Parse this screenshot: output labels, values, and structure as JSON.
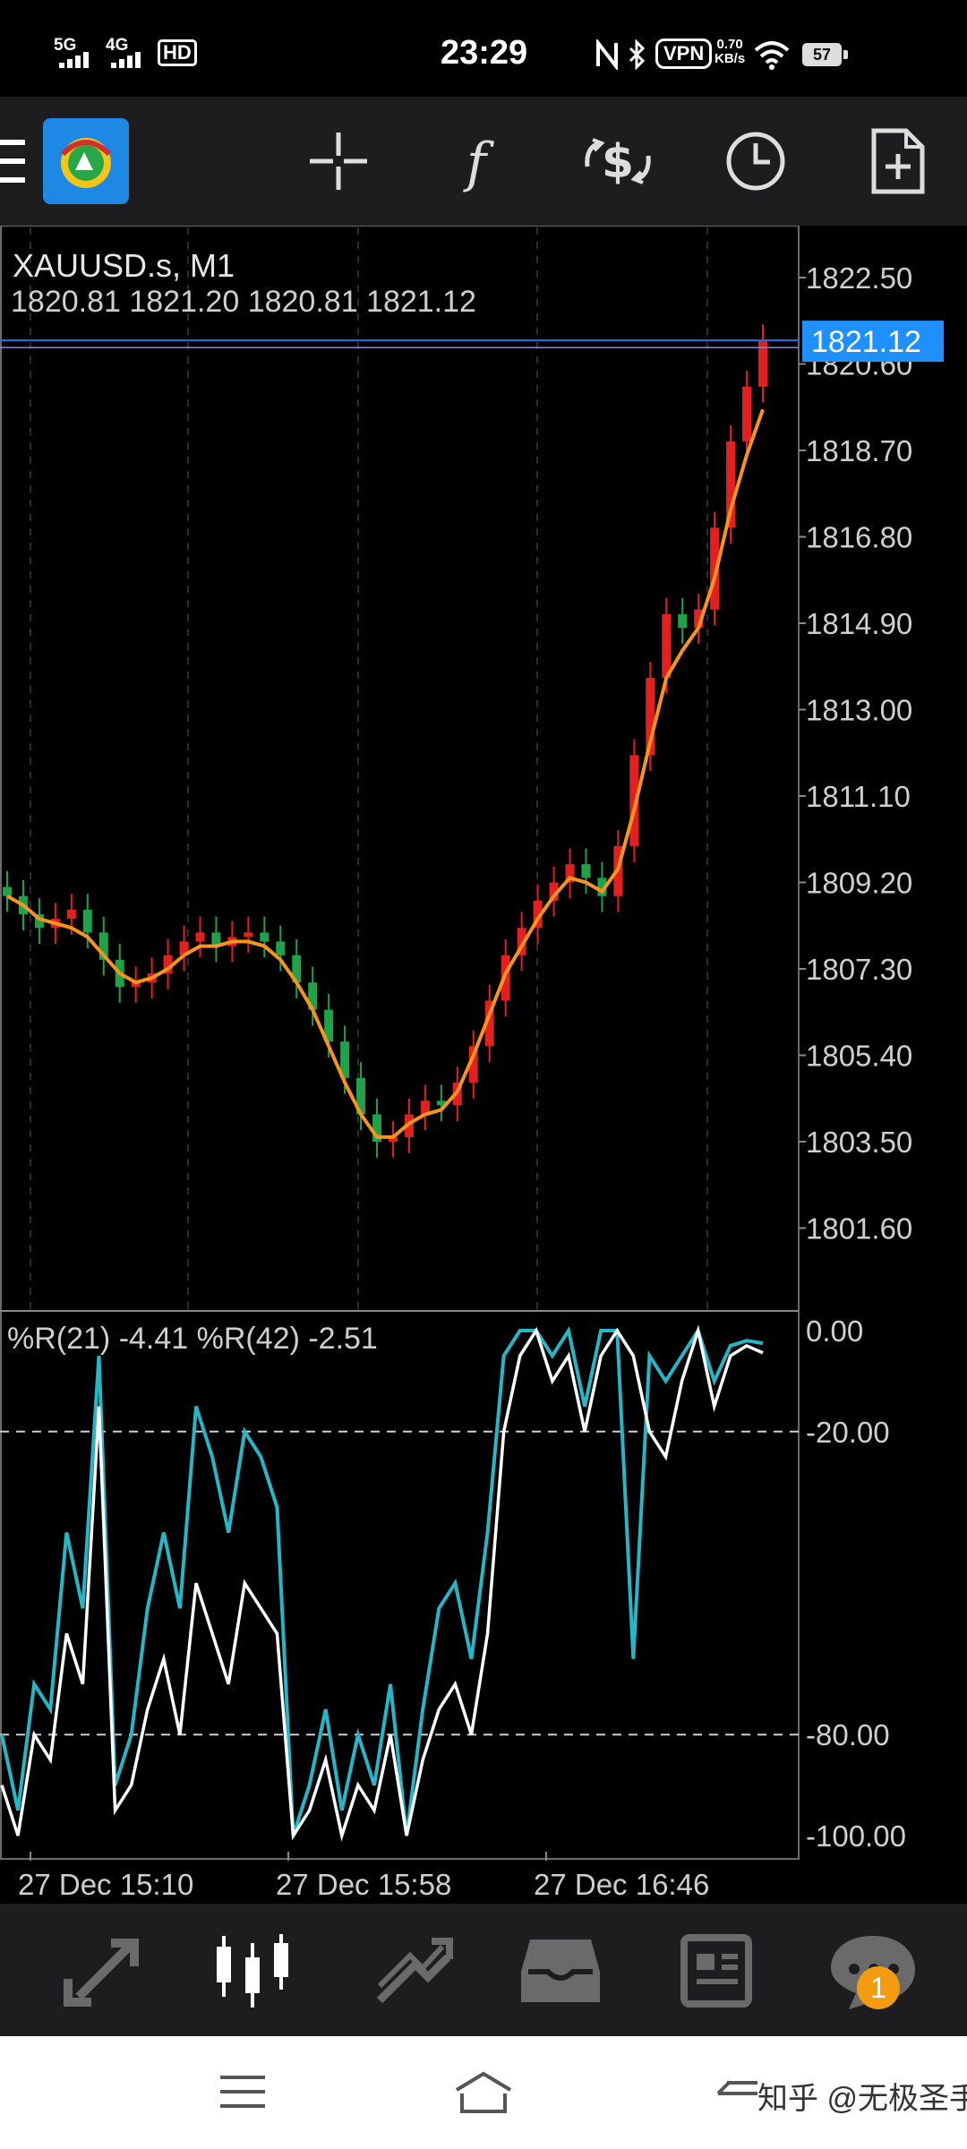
{
  "status_bar": {
    "network1": "5G",
    "network2": "4G",
    "hd_label": "HD",
    "time": "23:29",
    "vpn_label": "VPN",
    "speed_value": "0.70",
    "speed_unit": "KB/s",
    "battery": "57"
  },
  "toolbar": {
    "app_logo": "metatrader-logo-icon",
    "items": [
      "menu-icon",
      "crosshair-icon",
      "indicators-icon",
      "trade-icon",
      "timeframe-clock-icon",
      "new-order-icon"
    ]
  },
  "chart": {
    "symbol_label": "XAUUSD.s, M1",
    "ohlc": "1820.81 1821.20 1820.81 1821.12",
    "current_price": "1821.12",
    "price_ticks": [
      "1822.50",
      "1820.60",
      "1818.70",
      "1816.80",
      "1814.90",
      "1813.00",
      "1811.10",
      "1809.20",
      "1807.30",
      "1805.40",
      "1803.50",
      "1801.60"
    ],
    "indicator_label": "%R(21) -4.41 %R(42) -2.51",
    "indicator_ticks": [
      "0.00",
      "-20.00",
      "-80.00",
      "-100.00"
    ],
    "time_labels": [
      "27 Dec 15:10",
      "27 Dec 15:58",
      "27 Dec 16:46"
    ],
    "colors": {
      "bull": "#e32020",
      "bear": "#1fa24a",
      "ma": "#f7941d",
      "wpr21": "#ffffff",
      "wpr42": "#27b6c6",
      "price_line": "#2a6ee8",
      "price_badge": "#1e90ff"
    }
  },
  "chart_data": [
    {
      "type": "line",
      "title": "XAUUSD.s, M1",
      "series": [
        {
          "values": [
            1808.9,
            1808.5,
            1808.2,
            1808.4,
            1808.6,
            1808.1,
            1807.5,
            1806.9,
            1807.0,
            1807.2,
            1807.6,
            1807.9,
            1808.1,
            1807.8,
            1808.0,
            1808.1,
            1807.9,
            1807.6,
            1807.0,
            1806.4,
            1805.7,
            1804.9,
            1804.1,
            1803.5,
            1803.6,
            1804.1,
            1804.4,
            1804.3,
            1804.8,
            1805.6,
            1806.6,
            1807.6,
            1808.2,
            1808.8,
            1809.2,
            1809.6,
            1809.3,
            1808.9,
            1810.0,
            1812.0,
            1813.7,
            1815.1,
            1814.8,
            1815.2,
            1817.0,
            1818.9,
            1820.1,
            1821.12
          ]
        },
        {
          "values": [
            1808.9,
            1808.7,
            1808.4,
            1808.3,
            1808.2,
            1808.0,
            1807.6,
            1807.2,
            1807.0,
            1807.1,
            1807.3,
            1807.6,
            1807.8,
            1807.8,
            1807.9,
            1807.9,
            1807.8,
            1807.5,
            1807.0,
            1806.4,
            1805.6,
            1804.8,
            1804.1,
            1803.6,
            1803.6,
            1803.9,
            1804.1,
            1804.2,
            1804.6,
            1805.4,
            1806.3,
            1807.2,
            1807.8,
            1808.4,
            1808.9,
            1809.3,
            1809.2,
            1809.0,
            1809.5,
            1810.8,
            1812.3,
            1813.7,
            1814.3,
            1814.8,
            1815.9,
            1817.4,
            1818.6,
            1819.6
          ]
        }
      ],
      "ylim": [
        1800.0,
        1823.5
      ]
    },
    {
      "type": "line",
      "title": "%R(21) -4.41 %R(42) -2.51",
      "series": [
        {
          "values": [
            -90,
            -100,
            -80,
            -85,
            -60,
            -70,
            -15,
            -95,
            -90,
            -75,
            -65,
            -80,
            -50,
            -60,
            -70,
            -50,
            -55,
            -60,
            -100,
            -95,
            -85,
            -100,
            -90,
            -95,
            -80,
            -100,
            -85,
            -75,
            -70,
            -80,
            -60,
            -20,
            -5,
            0,
            -10,
            -5,
            -20,
            -5,
            0,
            -5,
            -20,
            -25,
            -10,
            0,
            -15,
            -5,
            -3,
            -4.41
          ]
        },
        {
          "values": [
            -80,
            -95,
            -70,
            -75,
            -40,
            -55,
            -5,
            -90,
            -80,
            -55,
            -40,
            -55,
            -15,
            -25,
            -40,
            -20,
            -25,
            -35,
            -100,
            -90,
            -75,
            -95,
            -80,
            -90,
            -70,
            -100,
            -75,
            -55,
            -50,
            -65,
            -40,
            -5,
            0,
            0,
            -5,
            0,
            -15,
            0,
            0,
            -65,
            -5,
            -10,
            -5,
            0,
            -10,
            -3,
            -2,
            -2.51
          ]
        }
      ],
      "ylim": [
        -100,
        0
      ]
    }
  ],
  "tabbar": {
    "items": [
      "quotes-icon",
      "chart-tab-icon",
      "trade-tab-icon",
      "history-tab-icon",
      "news-icon",
      "messages-icon"
    ],
    "badge_count": "1"
  },
  "system_nav": {
    "watermark": "知乎 @无极圣手"
  }
}
